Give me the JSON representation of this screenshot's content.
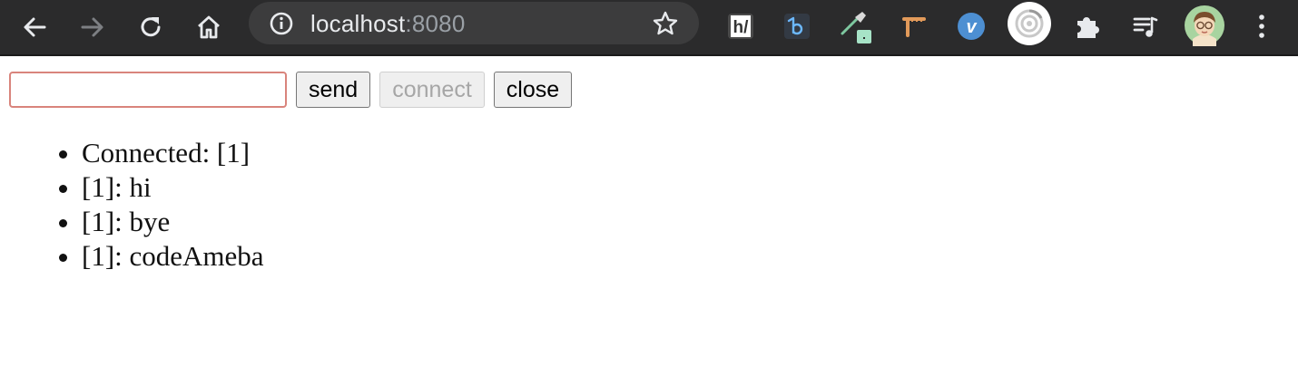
{
  "browser": {
    "url_host": "localhost",
    "url_port": ":8080",
    "toolbar_icons": [
      "back-arrow-icon",
      "forward-arrow-icon",
      "reload-icon",
      "home-icon",
      "info-icon",
      "star-icon"
    ],
    "extensions": [
      {
        "name": "hh-extension-icon",
        "label": "h/"
      },
      {
        "name": "b-extension-icon"
      },
      {
        "name": "eyedropper-extension-icon"
      },
      {
        "name": "ruler-extension-icon"
      },
      {
        "name": "vimeo-extension-icon",
        "label": "v"
      },
      {
        "name": "target-extension-icon"
      },
      {
        "name": "puzzle-icon"
      },
      {
        "name": "media-playlist-icon"
      },
      {
        "name": "profile-avatar"
      },
      {
        "name": "more-menu-icon"
      }
    ],
    "colors": {
      "toolbar_bg": "#2b2b2c",
      "omnibox_bg": "#3c3c3d",
      "input_focus_border": "#d9847c"
    }
  },
  "page": {
    "input": {
      "value": "",
      "placeholder": ""
    },
    "send_label": "send",
    "connect_label": "connect",
    "close_label": "close",
    "messages": [
      "Connected: [1]",
      "[1]: hi",
      "[1]: bye",
      "[1]: codeAmeba"
    ]
  }
}
